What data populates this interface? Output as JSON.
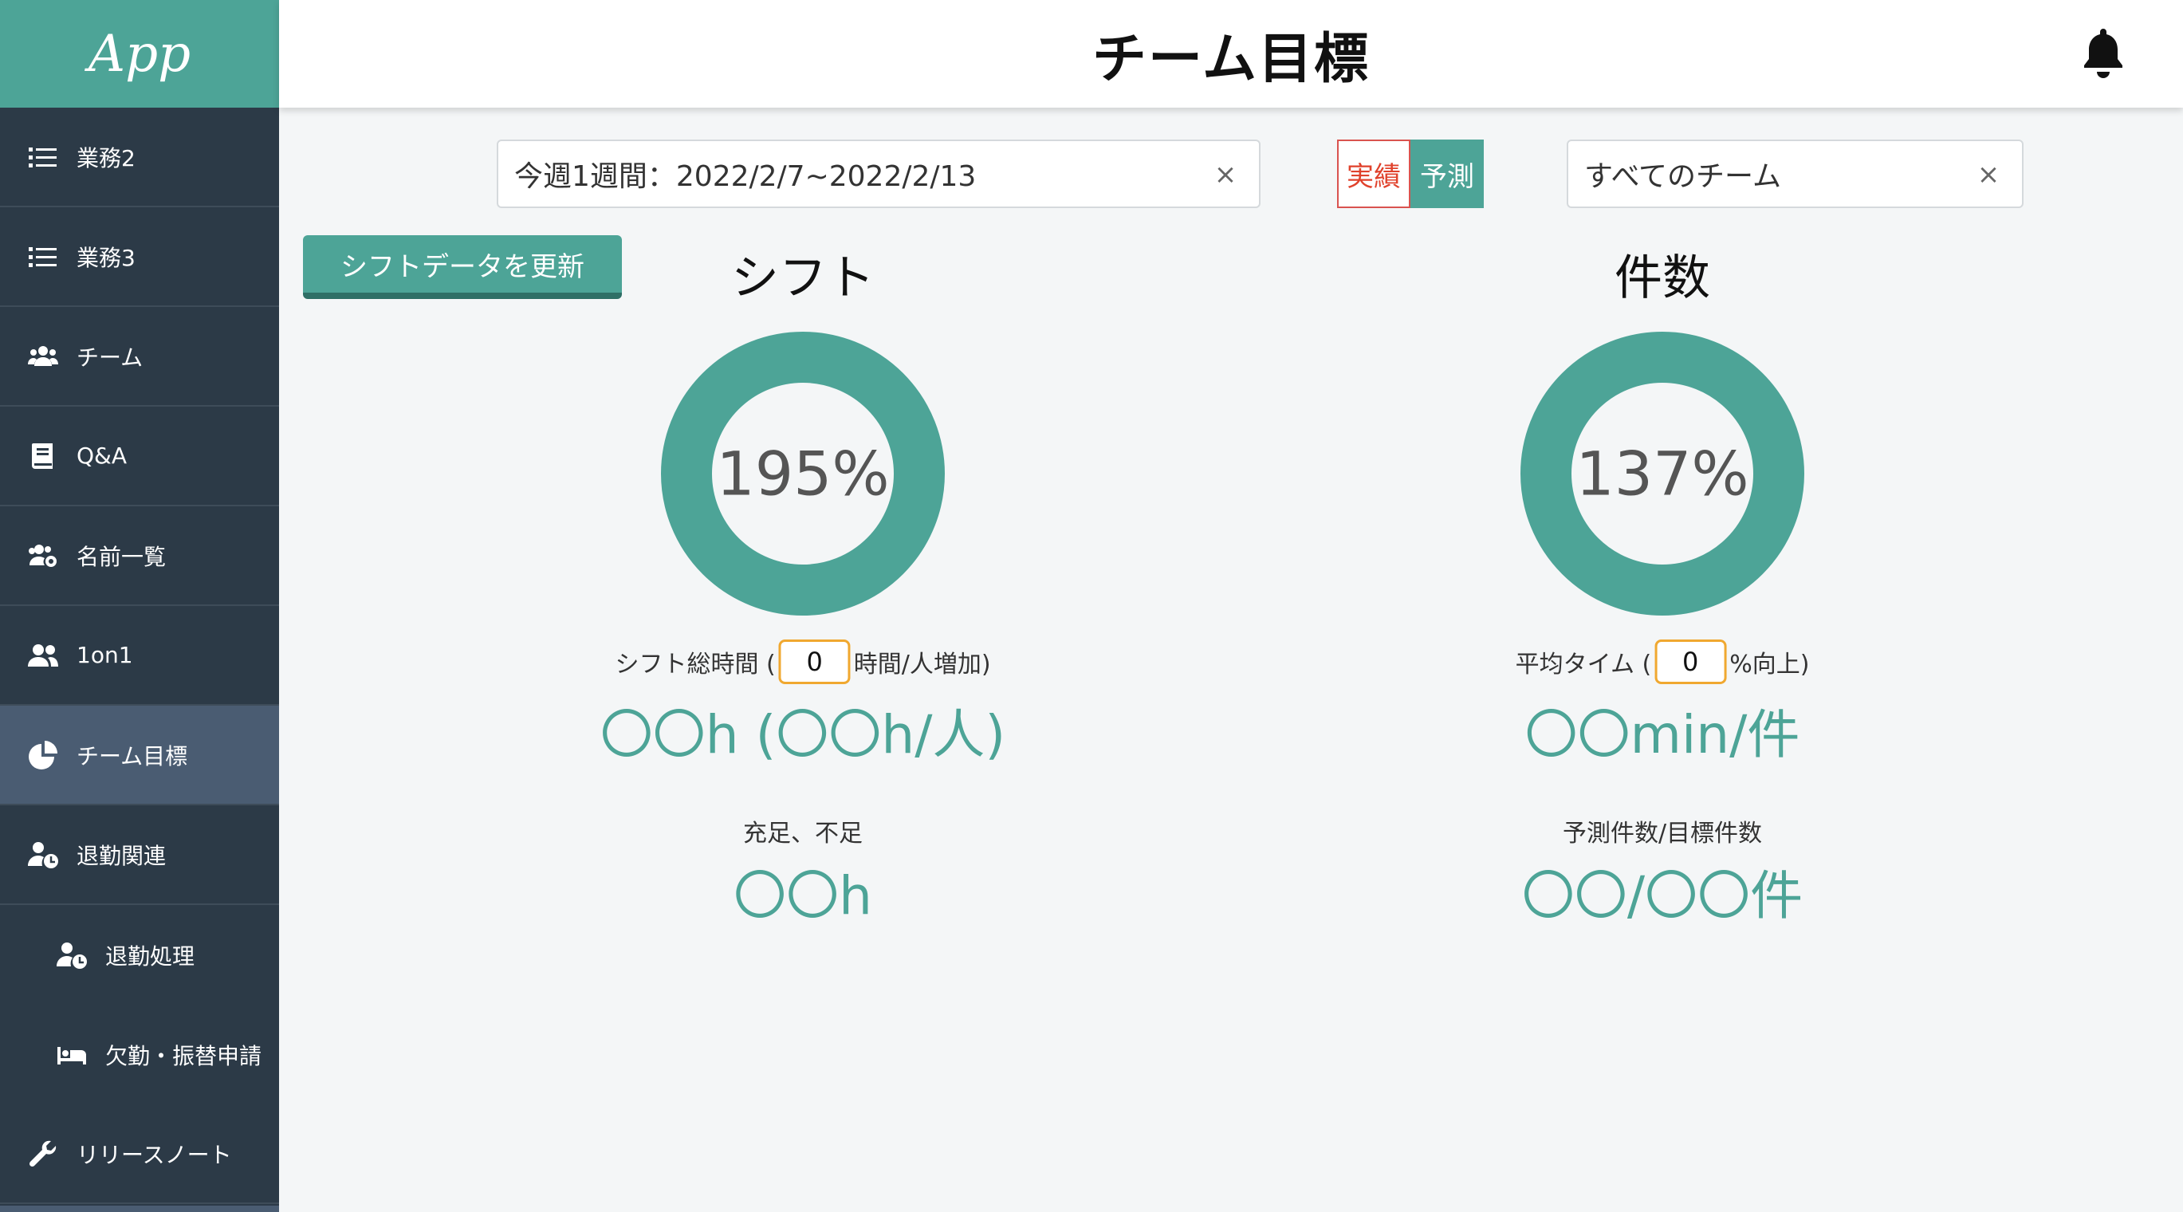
{
  "app": {
    "logo": "App"
  },
  "header": {
    "title": "チーム目標"
  },
  "sidebar": {
    "items": [
      {
        "label": "業務2",
        "icon": "list-icon"
      },
      {
        "label": "業務3",
        "icon": "list-icon"
      },
      {
        "label": "チーム",
        "icon": "users-icon"
      },
      {
        "label": "Q&A",
        "icon": "book-icon"
      },
      {
        "label": "名前一覧",
        "icon": "users-cog-icon"
      },
      {
        "label": "1on1",
        "icon": "user-friends-icon"
      },
      {
        "label": "チーム目標",
        "icon": "chart-pie-icon",
        "active": true
      },
      {
        "label": "退勤関連",
        "icon": "user-clock-icon"
      },
      {
        "label": "退勤処理",
        "icon": "user-clock-icon",
        "sub": true
      },
      {
        "label": "欠勤・振替申請",
        "icon": "bed-icon",
        "sub": true
      },
      {
        "label": "リリースノート",
        "icon": "wrench-icon"
      }
    ]
  },
  "filters": {
    "period": "今週1週間：2022/2/7~2022/2/13",
    "team": "すべてのチーム",
    "clear": "×",
    "toggle_actual": "実績",
    "toggle_forecast": "予測"
  },
  "actions": {
    "update_shift": "シフトデータを更新"
  },
  "shift_panel": {
    "title": "シフト",
    "percent_value": 195,
    "percent_label": "195%",
    "total_label_prefix": "シフト総時間 (",
    "total_input": "0",
    "total_label_suffix": "時間/人増加)",
    "total_value": "〇〇h (〇〇h/人)",
    "sufficiency_label": "充足、不足",
    "sufficiency_value": "〇〇h"
  },
  "count_panel": {
    "title": "件数",
    "percent_value": 137,
    "percent_label": "137%",
    "avg_label_prefix": "平均タイム (",
    "avg_input": "0",
    "avg_label_suffix": "%向上)",
    "avg_value": "〇〇min/件",
    "ratio_label": "予測件数/目標件数",
    "ratio_value": "〇〇/〇〇件"
  },
  "colors": {
    "accent": "#4da497",
    "sidebar": "#2c3a47",
    "active": "#4a5c72",
    "input_border": "#f0a830",
    "danger": "#e0422c"
  }
}
